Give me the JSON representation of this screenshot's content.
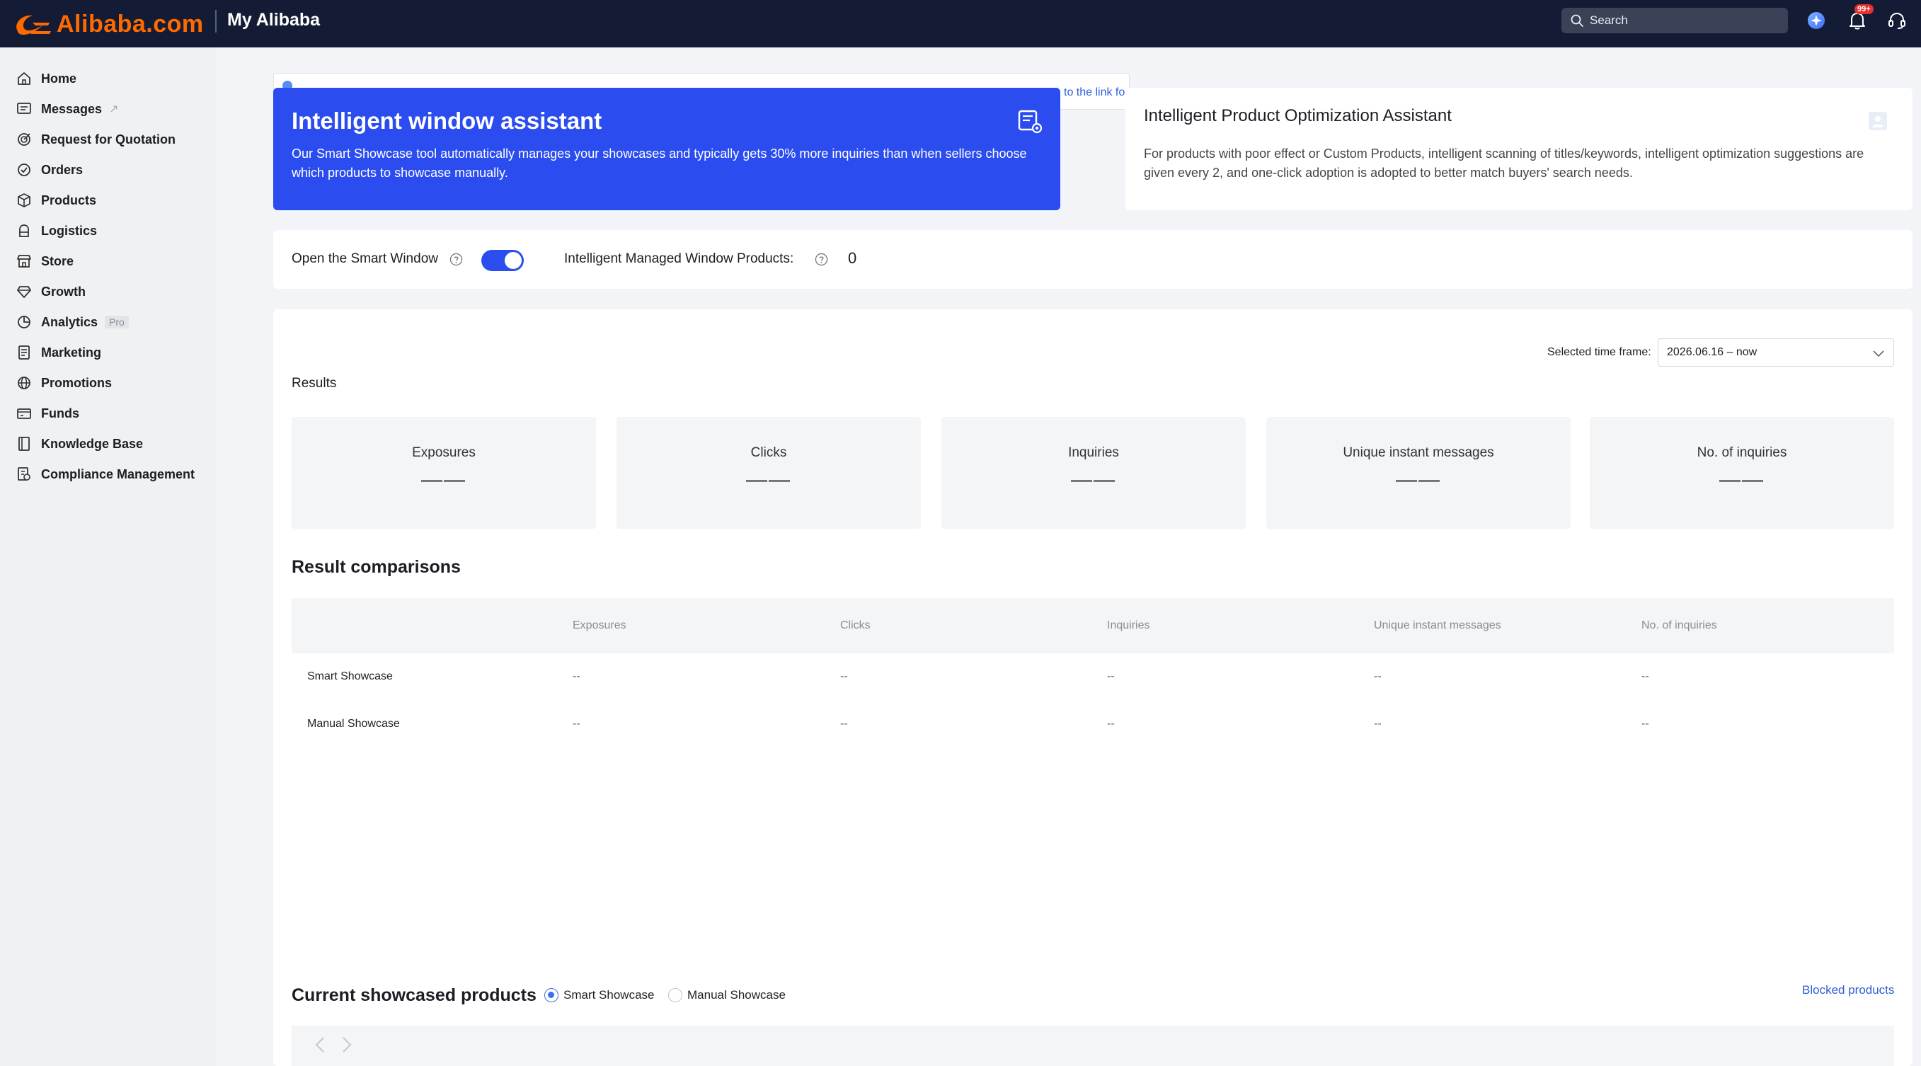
{
  "header": {
    "logo_text": "Alibaba.com",
    "portal_title": "My Alibaba",
    "search_placeholder": "Search",
    "notification_badge": "99+",
    "brand_color": "#ff6a00",
    "bar_color": "#131c34"
  },
  "sidebar": {
    "items": [
      {
        "label": "Home",
        "icon": "home-icon"
      },
      {
        "label": "Messages",
        "icon": "message-icon",
        "external": "↗"
      },
      {
        "label": "Request for Quotation",
        "icon": "rfq-icon"
      },
      {
        "label": "Orders",
        "icon": "orders-icon"
      },
      {
        "label": "Products",
        "icon": "box-icon"
      },
      {
        "label": "Logistics",
        "icon": "logistics-icon"
      },
      {
        "label": "Store",
        "icon": "store-icon"
      },
      {
        "label": "Growth",
        "icon": "diamond-icon"
      },
      {
        "label": "Analytics",
        "icon": "chart-icon",
        "badge": "Pro"
      },
      {
        "label": "Marketing",
        "icon": "marketing-icon"
      },
      {
        "label": "Promotions",
        "icon": "globe-icon"
      },
      {
        "label": "Funds",
        "icon": "funds-icon"
      },
      {
        "label": "Knowledge Base",
        "icon": "book-icon"
      },
      {
        "label": "Compliance Management",
        "icon": "compliance-icon"
      }
    ]
  },
  "notice": {
    "link_text": "to the link fo"
  },
  "assistant_card": {
    "title": "Intelligent window assistant",
    "description": "Our Smart Showcase tool automatically manages your showcases and typically gets 30% more inquiries than when sellers choose which products to showcase manually.",
    "color": "#2b4df0"
  },
  "optimization_card": {
    "title": "Intelligent Product Optimization Assistant",
    "description": "For products with poor effect or Custom Products, intelligent scanning of titles/keywords, intelligent optimization suggestions are given every 2, and one-click adoption is adopted to better match buyers' search needs."
  },
  "smart_window": {
    "toggle_label": "Open the Smart Window",
    "toggle_on": true,
    "managed_label": "Intelligent Managed Window Products:",
    "managed_count": "0"
  },
  "results": {
    "time_frame_label": "Selected time frame:",
    "time_frame_value": "2026.06.16 – now",
    "title": "Results",
    "metrics": [
      {
        "label": "Exposures",
        "value": "——"
      },
      {
        "label": "Clicks",
        "value": "——"
      },
      {
        "label": "Inquiries",
        "value": "——"
      },
      {
        "label": "Unique instant messages",
        "value": "——"
      },
      {
        "label": "No. of inquiries",
        "value": "——"
      }
    ]
  },
  "comparisons": {
    "title": "Result comparisons",
    "columns": [
      "Exposures",
      "Clicks",
      "Inquiries",
      "Unique instant messages",
      "No. of inquiries"
    ],
    "rows": [
      {
        "label": "Smart Showcase",
        "values": [
          "--",
          "--",
          "--",
          "--",
          "--"
        ]
      },
      {
        "label": "Manual Showcase",
        "values": [
          "--",
          "--",
          "--",
          "--",
          "--"
        ]
      }
    ]
  },
  "showcased": {
    "title": "Current showcased products",
    "options": [
      {
        "label": "Smart Showcase",
        "selected": true
      },
      {
        "label": "Manual Showcase",
        "selected": false
      }
    ],
    "blocked_link": "Blocked products"
  }
}
